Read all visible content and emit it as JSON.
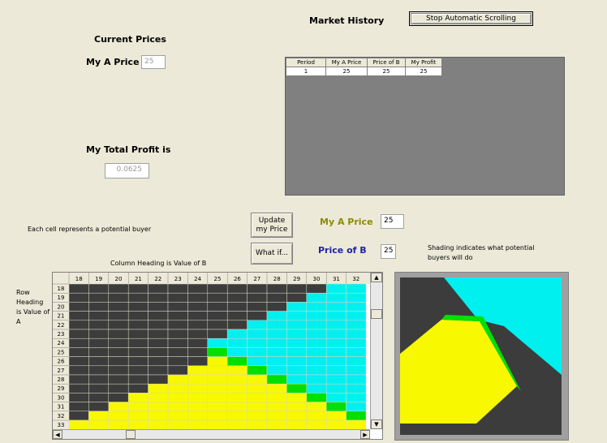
{
  "market_history": {
    "title": "Market History",
    "stop_button": "Stop Automatic Scrolling",
    "columns": [
      "Period",
      "My A Price",
      "Price of B",
      "My Profit"
    ],
    "rows": [
      [
        "1",
        "25",
        "25",
        "25"
      ]
    ]
  },
  "current_prices": {
    "title": "Current Prices",
    "my_a_price_label": "My A Price",
    "my_a_price_value": "25",
    "total_profit_label": "My Total Profit is",
    "total_profit_value": "0.0625"
  },
  "controls": {
    "each_cell_text": "Each cell represents a potential buyer",
    "update_button": "Update my Price",
    "whatif_button": "What if...",
    "my_a_price_label": "My A Price",
    "my_a_price_value": "25",
    "price_b_label": "Price of B",
    "price_b_value": "25",
    "shading_text": "Shading indicates what potential buyers will do"
  },
  "grid": {
    "column_heading": "Column Heading is Value of B",
    "row_heading": "Row Heading is Value of A",
    "columns": [
      "18",
      "19",
      "20",
      "21",
      "22",
      "23",
      "24",
      "25",
      "26",
      "27",
      "28",
      "29",
      "30",
      "31",
      "32"
    ],
    "rows": [
      "18",
      "19",
      "20",
      "21",
      "22",
      "23",
      "24",
      "25",
      "26",
      "27",
      "28",
      "29",
      "30",
      "31",
      "32",
      "33"
    ],
    "colors": {
      "dark": "#3c3c3c",
      "cyan": "#00f0f0",
      "yellow": "#f8f800",
      "green": "#00e000"
    }
  }
}
